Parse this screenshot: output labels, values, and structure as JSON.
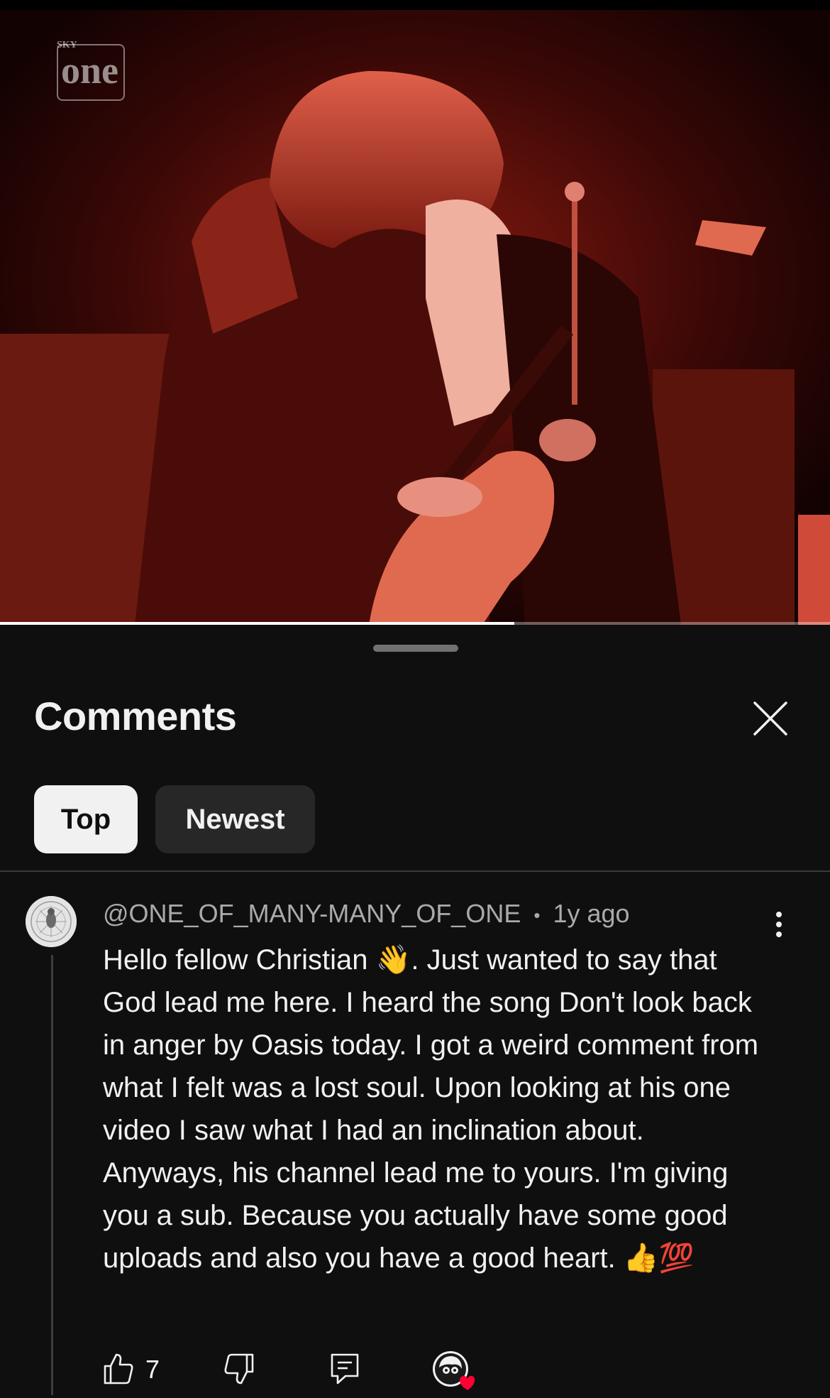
{
  "player": {
    "channel_logo_text": "one",
    "channel_logo_small": "SKY",
    "progress": 0.62
  },
  "comments_panel": {
    "title": "Comments",
    "close_icon": "close-icon",
    "sort_tabs": [
      {
        "label": "Top",
        "selected": true
      },
      {
        "label": "Newest",
        "selected": false
      }
    ]
  },
  "comment": {
    "author": "@ONE_OF_MANY-MANY_OF_ONE",
    "separator": "•",
    "age": "1y ago",
    "text": "Hello fellow Christian 👋. Just wanted to say that God lead me here. I heard the song Don't look back in anger by Oasis today. I got a weird comment from what I felt was a lost soul. Upon looking at his one video I saw what I had an inclination about. Anyways, his channel lead me to yours. I'm giving you a sub. Because you actually have some good uploads and also you have a good heart. 👍💯",
    "likes": "7",
    "icons": [
      "thumbs-up-icon",
      "thumbs-down-icon",
      "reply-icon",
      "creator-heart-icon",
      "more-vertical-icon"
    ]
  },
  "colors": {
    "background": "#0f0f0f",
    "chip_selected": "#f1f1f1",
    "chip_unselected": "#272727",
    "secondary_text": "#aaaaaa",
    "heart": "#ff0033"
  }
}
